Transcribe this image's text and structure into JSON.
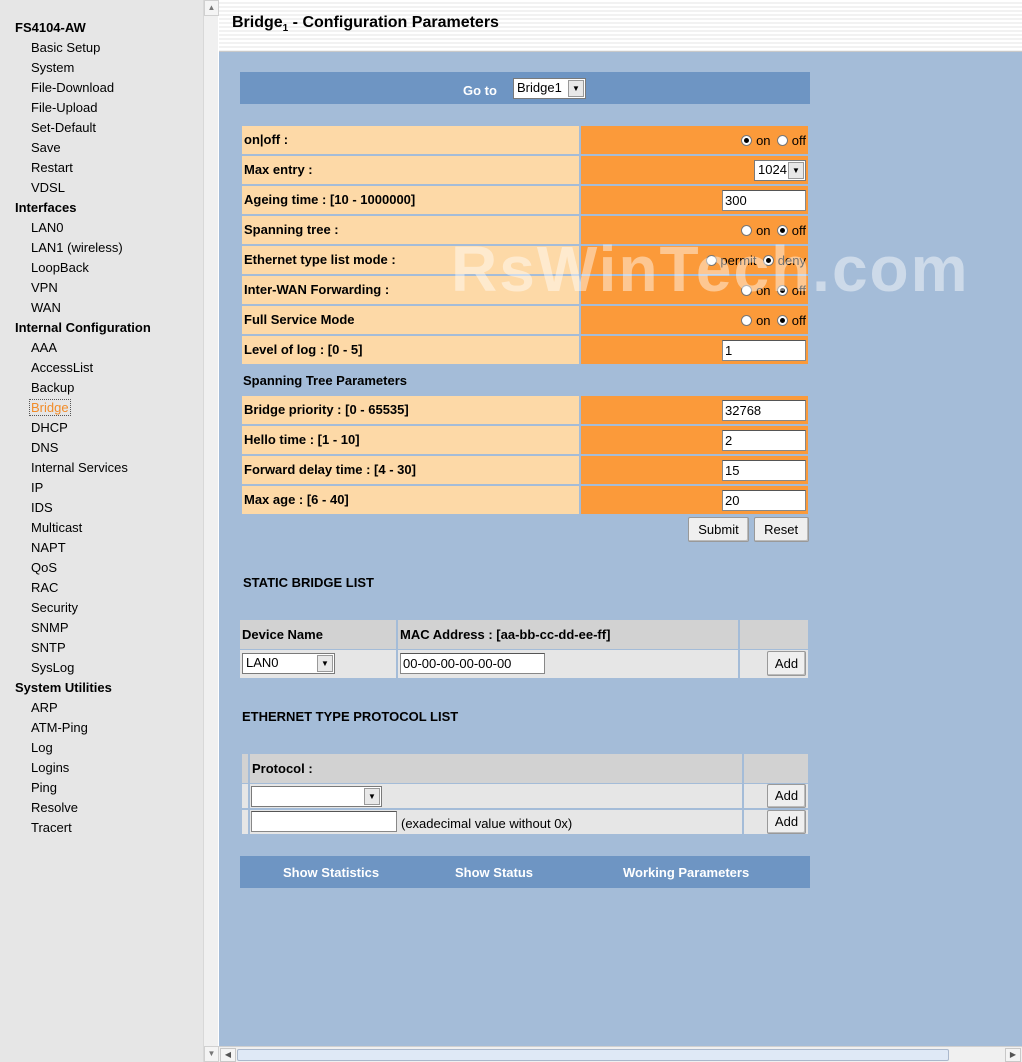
{
  "nav": {
    "sections": [
      {
        "title": "FS4104-AW",
        "items": [
          "Basic Setup",
          "System",
          "File-Download",
          "File-Upload",
          "Set-Default",
          "Save",
          "Restart",
          "VDSL"
        ]
      },
      {
        "title": "Interfaces",
        "items": [
          "LAN0",
          "LAN1 (wireless)",
          "LoopBack",
          "VPN",
          "WAN"
        ]
      },
      {
        "title": "Internal Configuration",
        "items": [
          "AAA",
          "AccessList",
          "Backup",
          "Bridge",
          "DHCP",
          "DNS",
          "Internal Services",
          "IP",
          "IDS",
          "Multicast",
          "NAPT",
          "QoS",
          "RAC",
          "Security",
          "SNMP",
          "SNTP",
          "SysLog"
        ]
      },
      {
        "title": "System Utilities",
        "items": [
          "ARP",
          "ATM-Ping",
          "Log",
          "Logins",
          "Ping",
          "Resolve",
          "Tracert"
        ]
      }
    ],
    "active": "Bridge"
  },
  "page": {
    "title_main": "Bridge",
    "title_sub": "1",
    "title_rest": " - Configuration Parameters",
    "watermark": "RsWinTech.com"
  },
  "goto": {
    "label": "Go to",
    "value": "Bridge1"
  },
  "params": {
    "onoff": {
      "label": "on|off :",
      "opt1": "on",
      "opt2": "off",
      "selected": "on"
    },
    "max_entry": {
      "label": "Max entry :",
      "value": "1024"
    },
    "ageing": {
      "label": "Ageing time : [10 - 1000000]",
      "value": "300"
    },
    "spanning": {
      "label": "Spanning tree :",
      "opt1": "on",
      "opt2": "off",
      "selected": "off"
    },
    "ethertype_mode": {
      "label": "Ethernet type list mode :",
      "opt1": "permit",
      "opt2": "deny",
      "selected": "deny"
    },
    "interwan": {
      "label": "Inter-WAN Forwarding :",
      "opt1": "on",
      "opt2": "off",
      "selected": "off"
    },
    "fullservice": {
      "label": "Full Service Mode",
      "opt1": "on",
      "opt2": "off",
      "selected": "off"
    },
    "loglevel": {
      "label": "Level of log : [0 - 5]",
      "value": "1"
    }
  },
  "stp": {
    "title": "Spanning Tree Parameters",
    "priority": {
      "label": "Bridge priority : [0 - 65535]",
      "value": "32768"
    },
    "hello": {
      "label": "Hello time : [1 - 10]",
      "value": "2"
    },
    "fwd_delay": {
      "label": "Forward delay time : [4 - 30]",
      "value": "15"
    },
    "max_age": {
      "label": "Max age : [6 - 40]",
      "value": "20"
    }
  },
  "buttons": {
    "submit": "Submit",
    "reset": "Reset",
    "add": "Add"
  },
  "static_list": {
    "title": "STATIC BRIDGE LIST",
    "col_device": "Device Name",
    "col_mac": "MAC Address : [aa-bb-cc-dd-ee-ff]",
    "device_value": "LAN0",
    "mac_value": "00-00-00-00-00-00"
  },
  "eth_list": {
    "title": "ETHERNET TYPE PROTOCOL LIST",
    "col_protocol": "Protocol :",
    "protocol_value": "",
    "hex_value": "",
    "hex_hint": "(exadecimal value without 0x)"
  },
  "footer": {
    "stats": "Show Statistics",
    "status": "Show Status",
    "working": "Working Parameters"
  }
}
